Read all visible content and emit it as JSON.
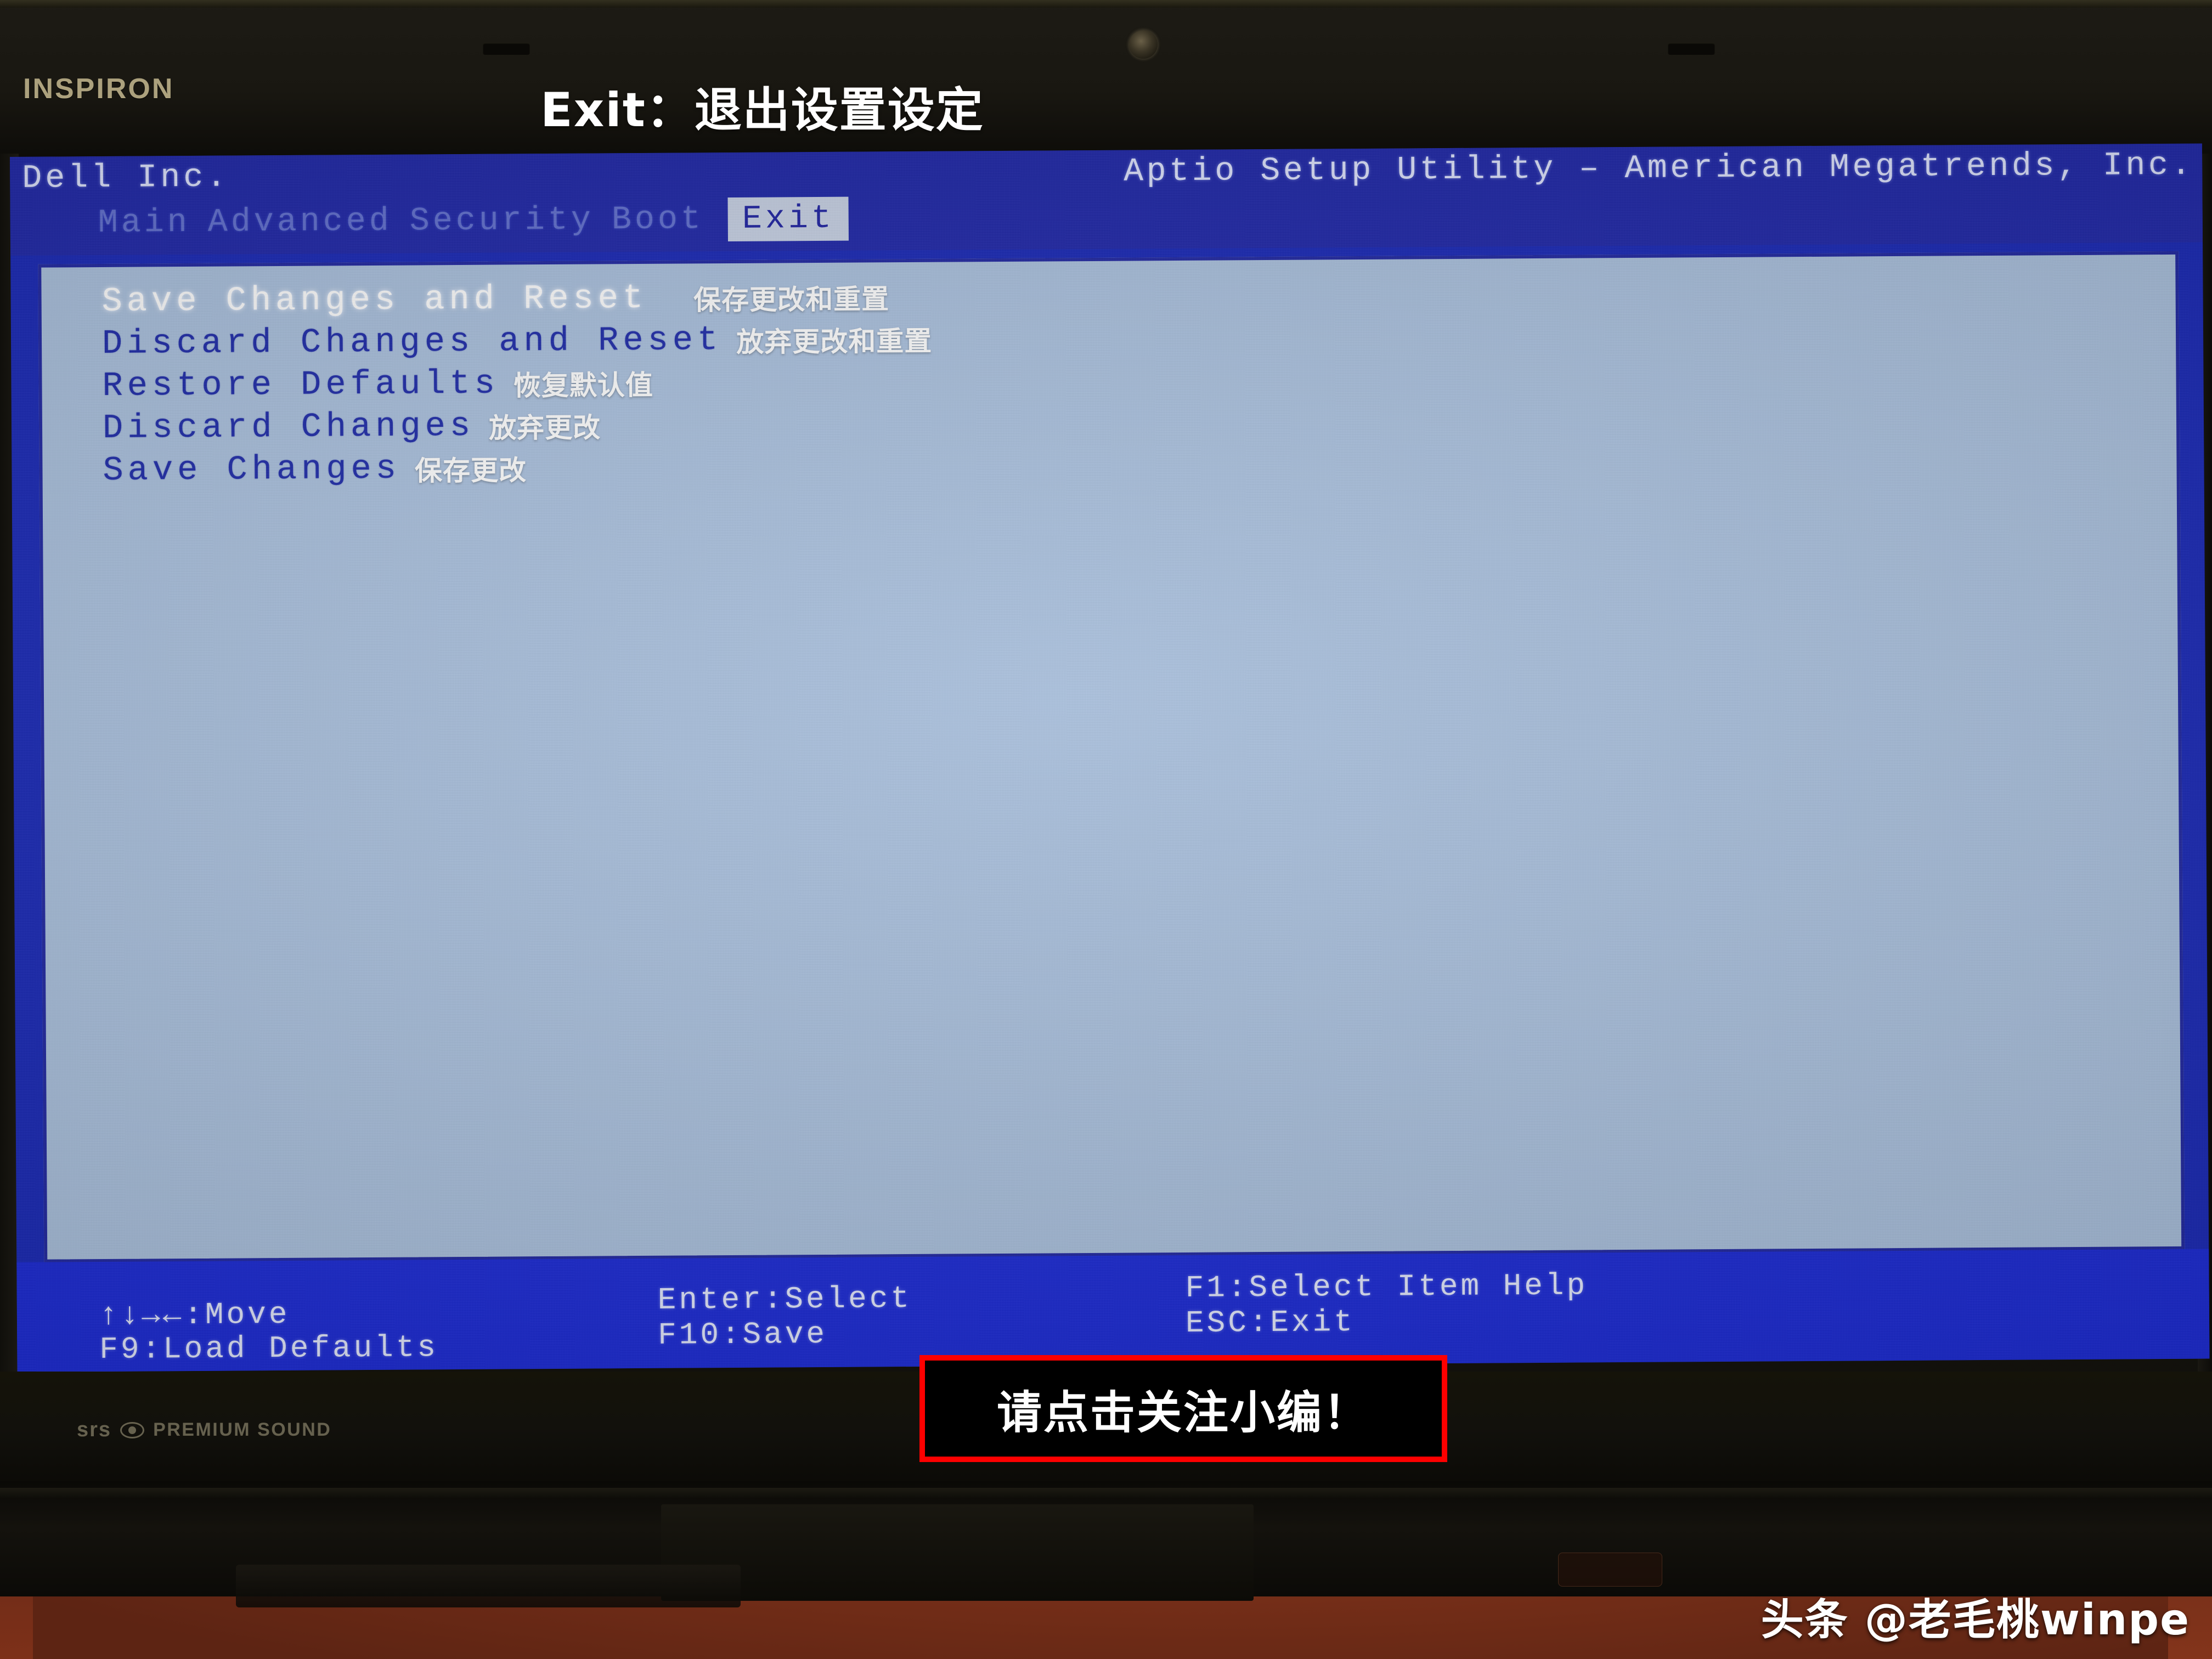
{
  "overlay": {
    "title": "Exit：退出设置设定",
    "cta": "请点击关注小编！",
    "watermark": "头条 @老毛桃winpe"
  },
  "laptop": {
    "brand_logo": "INSPIRON",
    "audio_badge": {
      "brand": "srs",
      "label": "PREMIUM SOUND"
    }
  },
  "bios": {
    "vendor": "Dell Inc.",
    "utility": "Aptio Setup Utility – American Megatrends, Inc.",
    "tabs": [
      {
        "label": "Main",
        "active": false
      },
      {
        "label": "Advanced",
        "active": false
      },
      {
        "label": "Security",
        "active": false
      },
      {
        "label": "Boot",
        "active": false
      },
      {
        "label": "Exit",
        "active": true
      }
    ],
    "menu_items": [
      {
        "label": "Save Changes and Reset",
        "note": "保存更改和重置",
        "selected": true
      },
      {
        "label": "Discard Changes and Reset",
        "note": "放弃更改和重置",
        "selected": false
      },
      {
        "label": "Restore Defaults",
        "note": "恢复默认值",
        "selected": false
      },
      {
        "label": "Discard Changes",
        "note": "放弃更改",
        "selected": false
      },
      {
        "label": "Save Changes",
        "note": "保存更改",
        "selected": false
      }
    ],
    "footer_keys": {
      "move": "↑↓→←:Move",
      "load_defaults": "F9:Load Defaults",
      "enter_select": "Enter:Select",
      "f10_save": "F10:Save",
      "f1_help": "F1:Select Item Help",
      "esc_exit": "ESC:Exit"
    }
  },
  "colors": {
    "bios_header_blue": "#1b23a8",
    "bios_footer_blue": "#1726d6",
    "bios_panel_bg": "#a9c0de",
    "bios_item_blue": "#1a27a8",
    "cta_border_red": "#fe0000"
  }
}
